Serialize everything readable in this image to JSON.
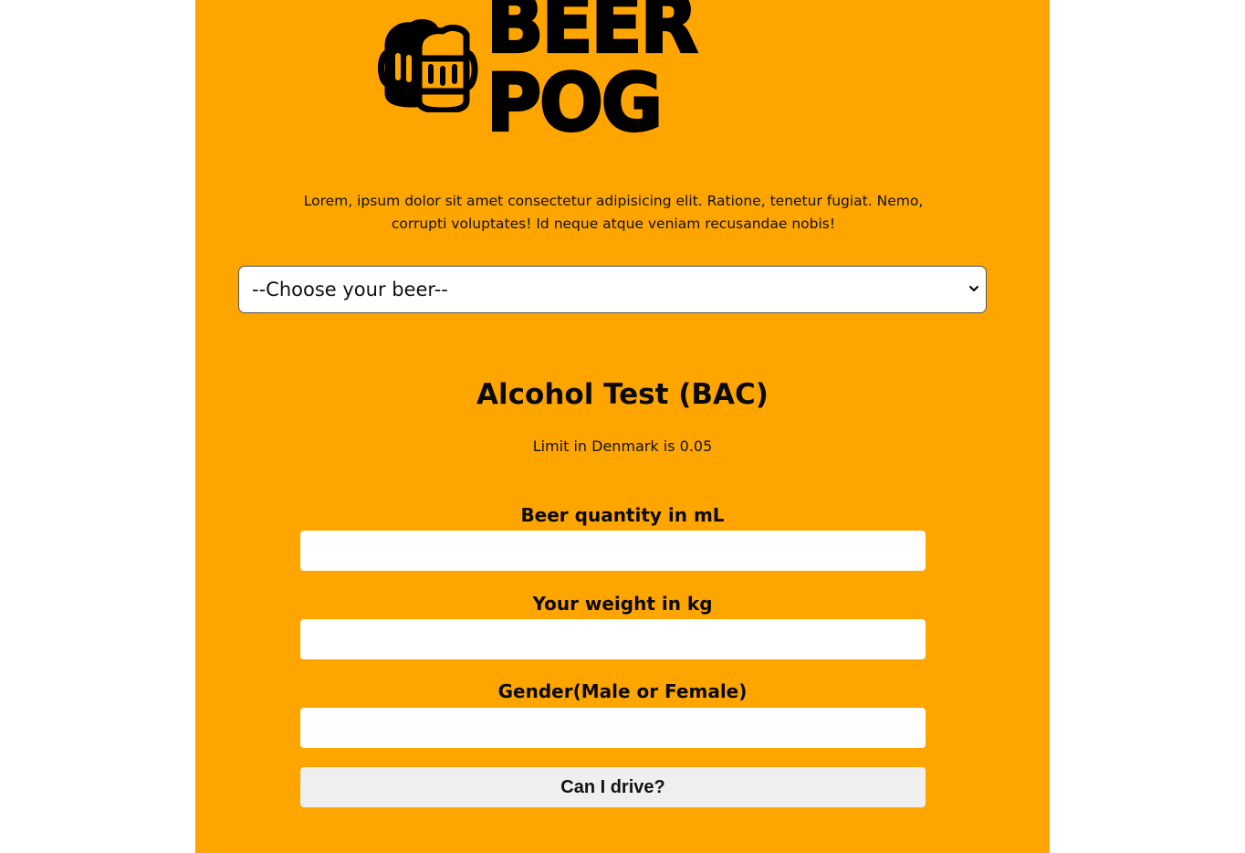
{
  "brand": {
    "name": "BEER POG",
    "icon": "beer-mugs-icon"
  },
  "intro_text": "Lorem, ipsum dolor sit amet consectetur adipisicing elit. Ratione, tenetur fugiat. Nemo, corrupti voluptates! Id neque atque veniam recusandae nobis!",
  "beer_select": {
    "selected": "--Choose your beer--",
    "icon": "chevron-down-icon"
  },
  "bac": {
    "title": "Alcohol Test (BAC)",
    "limit_text": "Limit in Denmark is 0.05"
  },
  "form": {
    "quantity_label": "Beer quantity in mL",
    "quantity_value": "",
    "weight_label": "Your weight in kg",
    "weight_value": "",
    "gender_label": "Gender(Male or Female)",
    "gender_value": "",
    "submit_label": "Can I drive?"
  },
  "colors": {
    "background": "#FFA500",
    "input_background": "#FFFFFF",
    "button_background": "#EFEFEF"
  }
}
